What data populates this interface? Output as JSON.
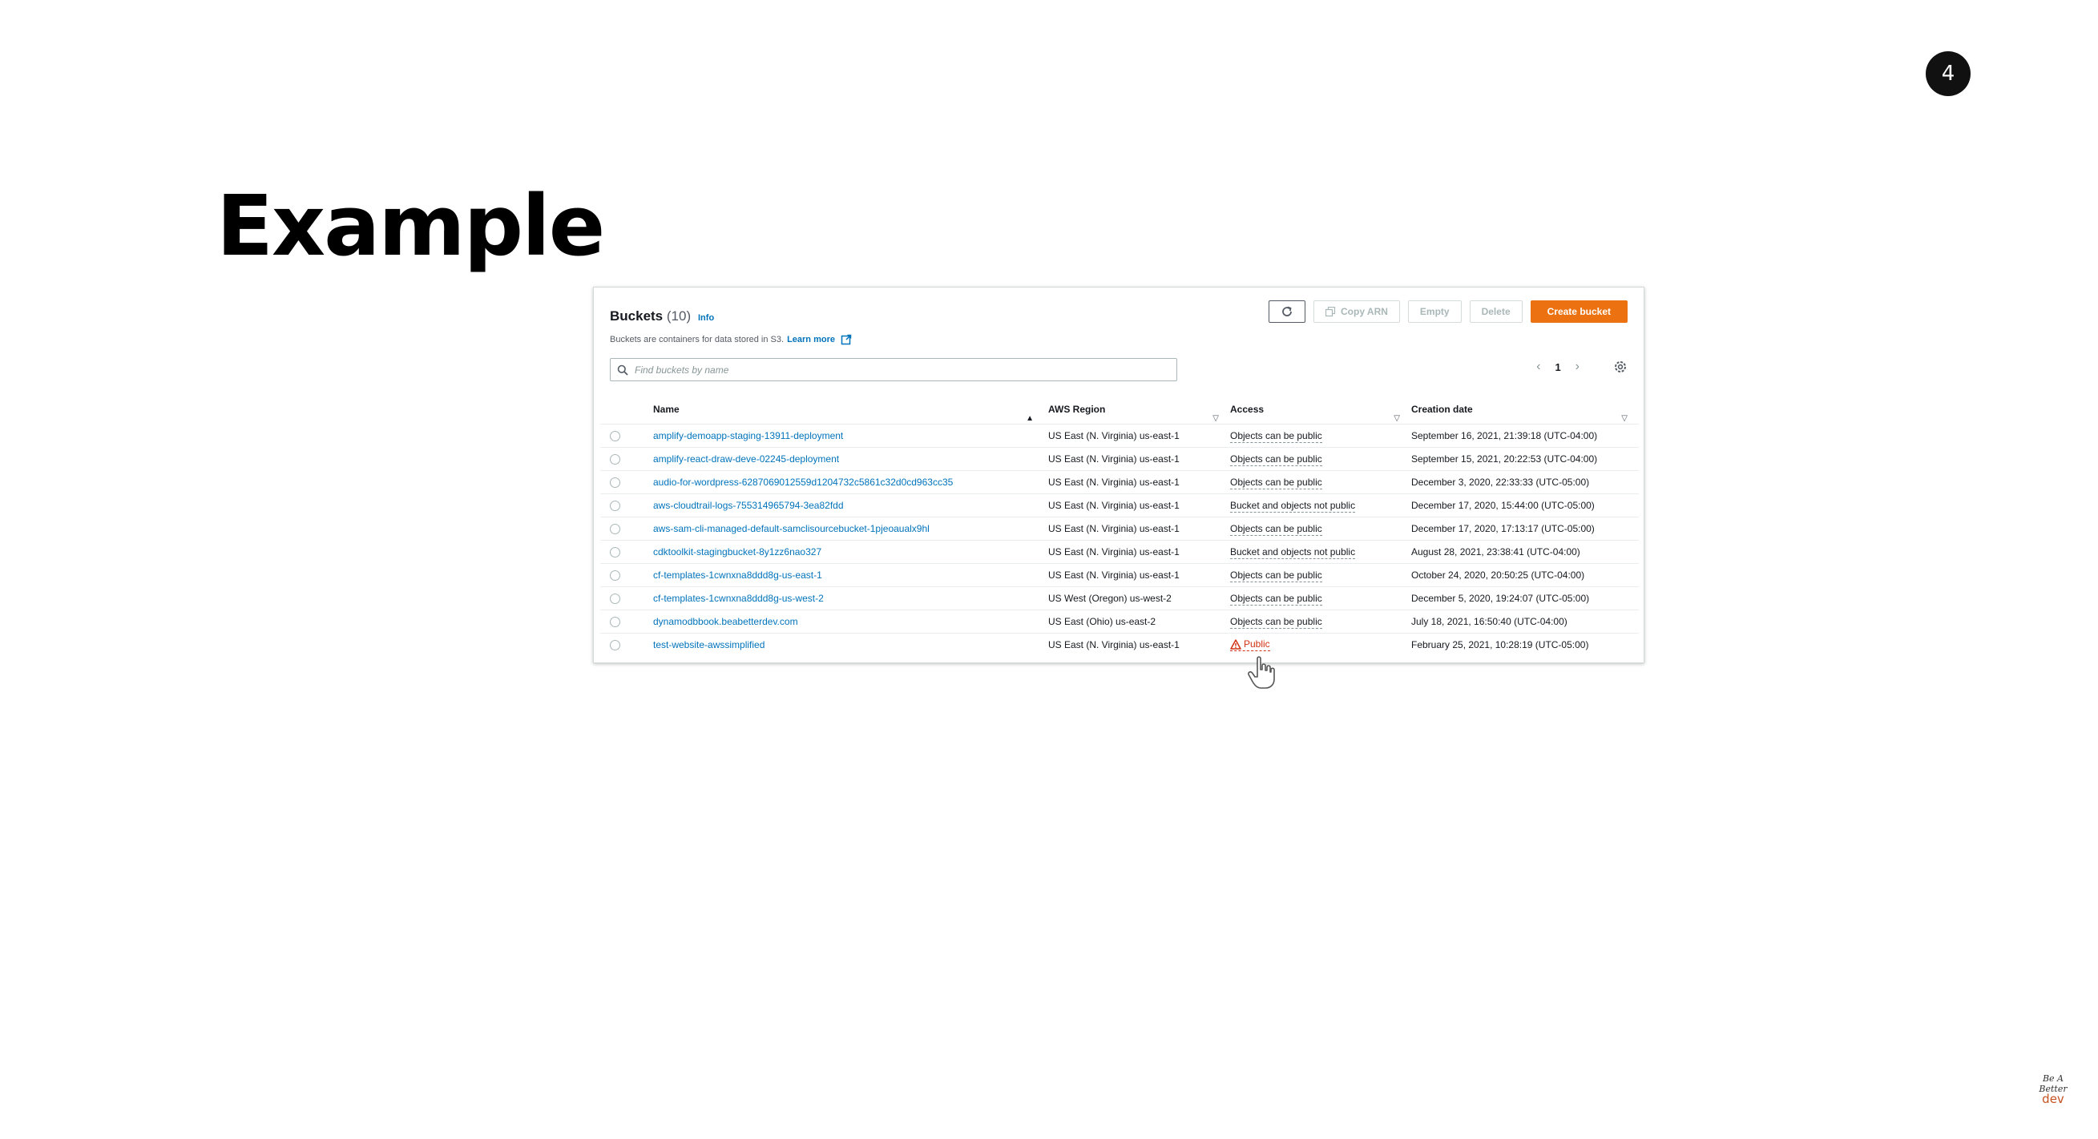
{
  "slide": {
    "badge": "4",
    "title": "Example"
  },
  "panel": {
    "title": "Buckets",
    "count": "(10)",
    "info_label": "Info",
    "description": "Buckets are containers for data stored in S3.",
    "learn_more": "Learn more",
    "toolbar": {
      "copy_arn": "Copy ARN",
      "empty": "Empty",
      "delete": "Delete",
      "create_bucket": "Create bucket"
    },
    "search": {
      "placeholder": "Find buckets by name"
    },
    "pagination": {
      "current_page": "1"
    },
    "columns": {
      "name": "Name",
      "region": "AWS Region",
      "access": "Access",
      "created": "Creation date"
    },
    "rows": [
      {
        "name": "amplify-demoapp-staging-13911-deployment",
        "region": "US East (N. Virginia) us-east-1",
        "access": "Objects can be public",
        "created": "September 16, 2021, 21:39:18 (UTC-04:00)"
      },
      {
        "name": "amplify-react-draw-deve-02245-deployment",
        "region": "US East (N. Virginia) us-east-1",
        "access": "Objects can be public",
        "created": "September 15, 2021, 20:22:53 (UTC-04:00)"
      },
      {
        "name": "audio-for-wordpress-6287069012559d1204732c5861c32d0cd963cc35",
        "region": "US East (N. Virginia) us-east-1",
        "access": "Objects can be public",
        "created": "December 3, 2020, 22:33:33 (UTC-05:00)"
      },
      {
        "name": "aws-cloudtrail-logs-755314965794-3ea82fdd",
        "region": "US East (N. Virginia) us-east-1",
        "access": "Bucket and objects not public",
        "created": "December 17, 2020, 15:44:00 (UTC-05:00)"
      },
      {
        "name": "aws-sam-cli-managed-default-samclisourcebucket-1pjeoaualx9hl",
        "region": "US East (N. Virginia) us-east-1",
        "access": "Objects can be public",
        "created": "December 17, 2020, 17:13:17 (UTC-05:00)"
      },
      {
        "name": "cdktoolkit-stagingbucket-8y1zz6nao327",
        "region": "US East (N. Virginia) us-east-1",
        "access": "Bucket and objects not public",
        "created": "August 28, 2021, 23:38:41 (UTC-04:00)"
      },
      {
        "name": "cf-templates-1cwnxna8ddd8g-us-east-1",
        "region": "US East (N. Virginia) us-east-1",
        "access": "Objects can be public",
        "created": "October 24, 2020, 20:50:25 (UTC-04:00)"
      },
      {
        "name": "cf-templates-1cwnxna8ddd8g-us-west-2",
        "region": "US West (Oregon) us-west-2",
        "access": "Objects can be public",
        "created": "December 5, 2020, 19:24:07 (UTC-05:00)"
      },
      {
        "name": "dynamodbbook.beabetterdev.com",
        "region": "US East (Ohio) us-east-2",
        "access": "Objects can be public",
        "created": "July 18, 2021, 16:50:40 (UTC-04:00)"
      },
      {
        "name": "test-website-awssimplified",
        "region": "US East (N. Virginia) us-east-1",
        "access": "Public",
        "access_status": "warning",
        "created": "February 25, 2021, 10:28:19 (UTC-05:00)"
      }
    ]
  },
  "watermark": {
    "line1": "Be A",
    "line2": "Better",
    "line3": "dev"
  },
  "colors": {
    "primary_button": "#ec7211",
    "link": "#0073bb",
    "warning": "#d13212"
  }
}
